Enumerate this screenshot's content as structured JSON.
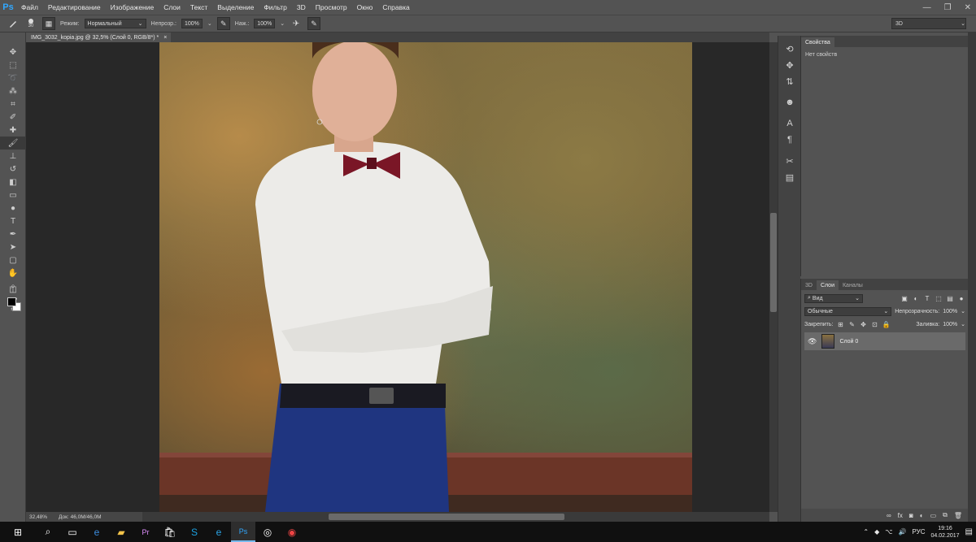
{
  "app": {
    "logo": "Ps"
  },
  "menu": [
    "Файл",
    "Редактирование",
    "Изображение",
    "Слои",
    "Текст",
    "Выделение",
    "Фильтр",
    "3D",
    "Просмотр",
    "Окно",
    "Справка"
  ],
  "window_controls": {
    "minimize": "—",
    "restore": "❐",
    "close": "✕"
  },
  "options": {
    "brush_size": "30",
    "mode_label": "Режим:",
    "mode_value": "Нормальный",
    "opacity_label": "Непрозр.:",
    "opacity_value": "100%",
    "pressure_label": "Наж.:",
    "pressure_value": "100%",
    "workspace": "3D"
  },
  "document_tab": {
    "title": "IMG_3032_kopia.jpg @ 32,5% (Слой 0, RGB/8*) *",
    "close": "×"
  },
  "status": {
    "zoom": "32,48%",
    "doc": "Док: 46,0M/46,0M"
  },
  "properties": {
    "tab": "Свойства",
    "empty_text": "Нет свойств"
  },
  "layers": {
    "tabs": [
      "3D",
      "Слои",
      "Каналы"
    ],
    "filter_label": "Вид",
    "blend_mode": "Обычные",
    "opacity_label": "Непрозрачность:",
    "opacity_value": "100%",
    "lock_label": "Закрепить:",
    "fill_label": "Заливка:",
    "fill_value": "100%",
    "layer_name": "Слой 0"
  },
  "taskbar": {
    "apps": [
      "start-icon",
      "search-icon",
      "task-view-icon",
      "edge-icon",
      "explorer-icon",
      "premiere-icon",
      "store-icon",
      "skype-icon",
      "ie-icon",
      "photoshop-icon",
      "media-icon",
      "chrome-icon"
    ],
    "lang": "РУС",
    "time": "19:16",
    "date": "04.02.2017"
  },
  "colors": {
    "accent": "#31a8ff",
    "panel": "#535353",
    "canvas": "#282828"
  }
}
